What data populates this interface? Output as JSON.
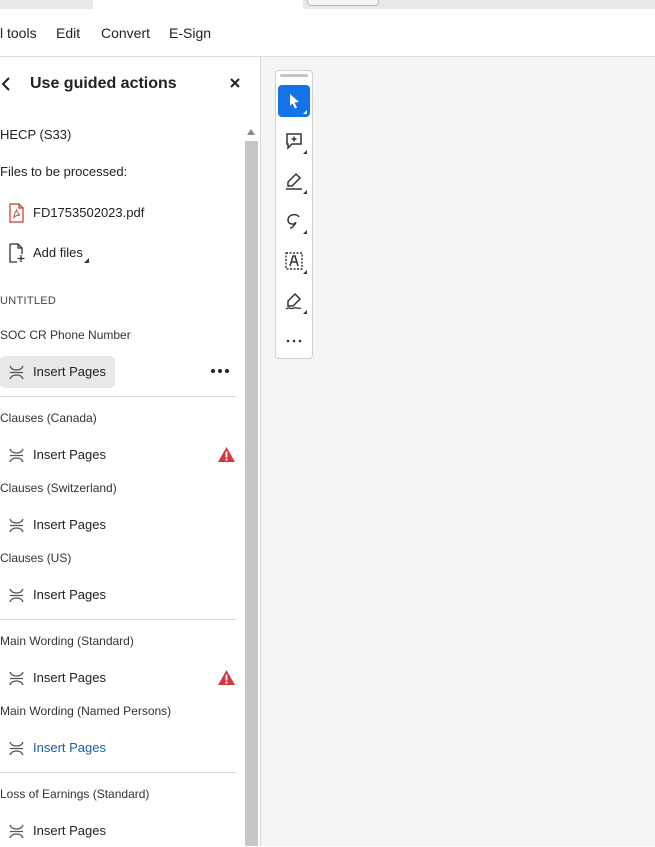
{
  "menu": [
    "l tools",
    "Edit",
    "Convert",
    "E-Sign"
  ],
  "panel": {
    "title": "Use guided actions",
    "action_name": "HECP (S33)",
    "files_label": "Files to be processed:",
    "file_name": "FD1753502023.pdf",
    "add_files": "Add files",
    "group_label": "UNTITLED",
    "steps": [
      {
        "name": "SOC CR Phone Number",
        "action": "Insert Pages",
        "state": "selected"
      },
      {
        "name": "Clauses (Canada)",
        "action": "Insert Pages",
        "state": "warning"
      },
      {
        "name": "Clauses (Switzerland)",
        "action": "Insert Pages",
        "state": "normal"
      },
      {
        "name": "Clauses (US)",
        "action": "Insert Pages",
        "state": "normal"
      },
      {
        "name": "Main Wording (Standard)",
        "action": "Insert Pages",
        "state": "warning"
      },
      {
        "name": "Main Wording (Named Persons)",
        "action": "Insert Pages",
        "state": "highlight"
      },
      {
        "name": "Loss of Earnings (Standard)",
        "action": "Insert Pages",
        "state": "normal"
      }
    ]
  },
  "toolbar": {
    "tools": [
      "select-tool",
      "add-comment-tool",
      "highlight-tool",
      "draw-freehand-tool",
      "add-text-tool",
      "sign-tool",
      "more-tools"
    ],
    "active": "select-tool",
    "accent": "#1473e6"
  },
  "colors": {
    "warning": "#d7373f",
    "link": "#1a5ea8"
  }
}
